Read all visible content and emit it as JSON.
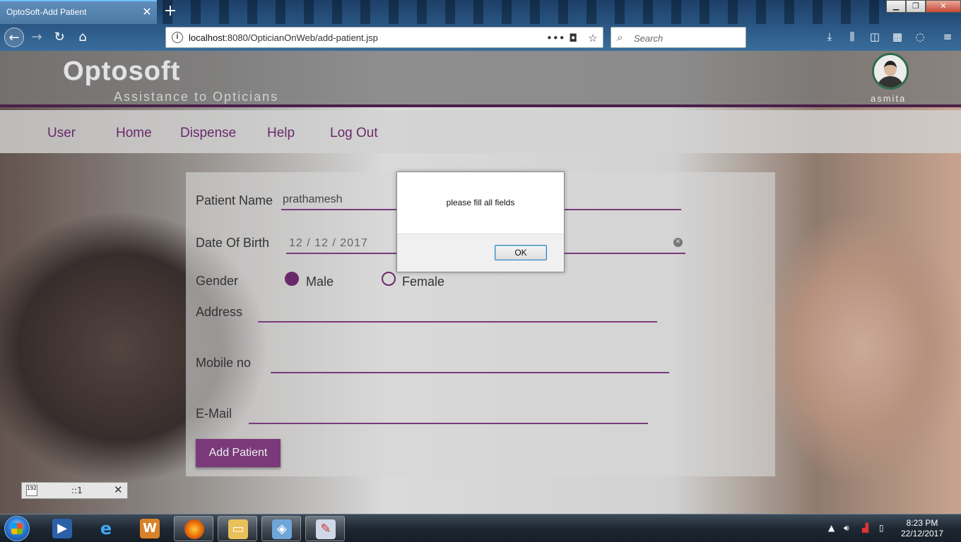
{
  "browser": {
    "tab_title": "OptoSoft-Add Patient",
    "url_host": "localhost",
    "url_rest": ":8080/OpticianOnWeb/add-patient.jsp",
    "search_placeholder": "Search",
    "window_controls": [
      "minimize-icon",
      "restore-icon",
      "close-icon"
    ]
  },
  "site": {
    "logo_title": "Optosoft",
    "logo_subtitle": "Assistance to Opticians",
    "username": "asmita",
    "menu": [
      "User",
      "Home",
      "Dispense",
      "Help",
      "Log Out"
    ]
  },
  "form": {
    "patient_name_label": "Patient Name",
    "patient_name_value": "prathamesh",
    "dob_label": "Date Of Birth",
    "dob_value": "12 / 12 / 2017",
    "gender_label": "Gender",
    "gender_options": [
      "Male",
      "Female"
    ],
    "gender_selected": "Male",
    "address_label": "Address",
    "mobile_label": "Mobile no",
    "email_label": "E-Mail",
    "submit_label": "Add Patient"
  },
  "dialog": {
    "message": "please fill all fields",
    "ok_label": "OK"
  },
  "mini_widget": {
    "text": "::1"
  },
  "taskbar": {
    "time": "8:23 PM",
    "date": "22/12/2017"
  },
  "colors": {
    "accent": "#7a3a7a",
    "header_border": "#4a1f4a",
    "menu_text": "#6a2a6a"
  }
}
